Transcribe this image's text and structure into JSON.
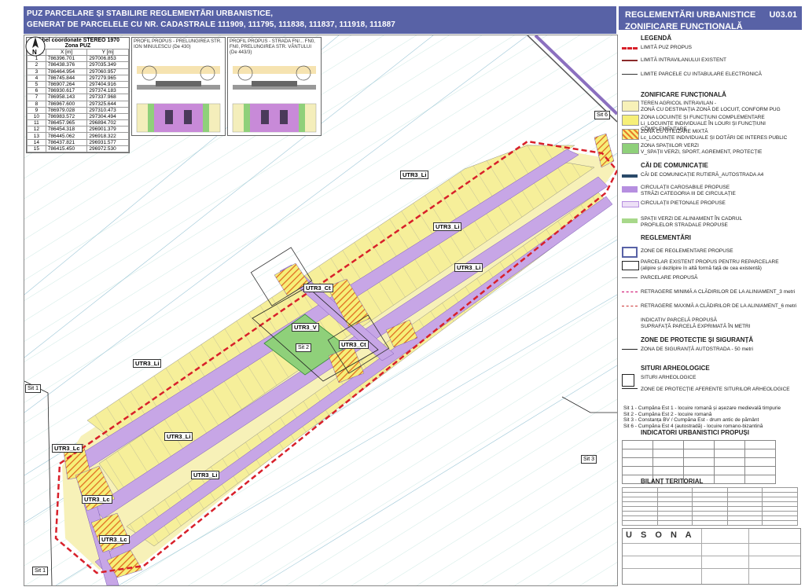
{
  "title": {
    "line1": "PUZ PARCELARE ȘI STABILIRE REGLEMENTĂRI URBANISTICE,",
    "line2": "GENERAT DE PARCELELE CU NR. CADASTRALE  111909, 111795, 111838, 111837, 111918, 111887"
  },
  "sheet": {
    "title": "REGLEMENTĂRI URBANISTICE",
    "subtitle": "ZONIFICARE FUNCȚIONALĂ",
    "code": "U03.01"
  },
  "coord_table": {
    "caption": "Tabel coordonate STEREO 1970",
    "subcaption": "Zona PUZ",
    "headers": [
      "Nr.pct.",
      "X [m]",
      "Y [m]"
    ],
    "rows": [
      [
        "1",
        "786396.701",
        "297006.853"
      ],
      [
        "2",
        "786438.376",
        "297035.349"
      ],
      [
        "3",
        "786464.954",
        "297060.957"
      ],
      [
        "4",
        "786745.844",
        "297279.965"
      ],
      [
        "5",
        "786907.264",
        "297404.916"
      ],
      [
        "6",
        "786930.617",
        "297374.183"
      ],
      [
        "7",
        "786958.143",
        "297337.968"
      ],
      [
        "8",
        "786967.600",
        "297325.644"
      ],
      [
        "9",
        "786979.028",
        "297310.473"
      ],
      [
        "10",
        "786983.572",
        "297304.494"
      ],
      [
        "11",
        "786457.965",
        "296894.702"
      ],
      [
        "12",
        "786454.318",
        "296901.379"
      ],
      [
        "13",
        "786445.062",
        "296918.322"
      ],
      [
        "14",
        "786437.821",
        "296931.577"
      ],
      [
        "15",
        "786415.450",
        "296972.530"
      ]
    ]
  },
  "profiles": [
    {
      "title": "PROFIL PROPUS - PRELUNGIREA STR. ION MINULESCU (De 430)"
    },
    {
      "title": "PROFIL PROPUS - STRADA FN/... FN0, FN0, PRELUNGIREA STR. VÂNTULUI (De 443/3)"
    }
  ],
  "map_labels": {
    "utr3_li": "UTR3_Li",
    "utr3_lc": "UTR3_Lc",
    "utr3_ct": "UTR3_Ct",
    "utr3_v": "UTR3_V",
    "sit1": "Sit 1",
    "sit2": "Sit 2",
    "sit3": "Sit 3",
    "sit6": "Sit 6",
    "de4433": "De 443/3"
  },
  "legend": {
    "heading": "LEGENDĂ",
    "items": [
      "LIMITĂ PUZ PROPUS",
      "LIMITĂ INTRAVILANULUI EXISTENT",
      "LIMITE PARCELE CU INTABULARE ELECTRONICĂ"
    ],
    "zon_heading": "ZONIFICARE FUNCȚIONALĂ",
    "zon_items": [
      {
        "l1": "TEREN AGRICOL INTRAVILAN -",
        "l2": "ZONĂ CU DESTINAȚIA ZONĂ DE LOCUIT, CONFORM PUG",
        "color": "#f7f1b8"
      },
      {
        "l1": "ZONA LOCUINȚE ȘI FUNCȚIUNI COMPLEMENTARE",
        "l2": "Li_LOCUINȚE INDIVIDUALE ÎN LOURI ȘI FUNCȚIUNI COMPLEMENTARE",
        "color": "#f6ef78"
      },
      {
        "l1": "ZONA CU UTILIZARE MIXTĂ",
        "l2": "Lc_LOCUINȚE INDIVIDUALE ȘI DOTĂRI DE INTERES PUBLIC",
        "color": "#e87a2a"
      },
      {
        "l1": "ZONA SPAȚIILOR VERZI",
        "l2": "V_SPAȚII VERZI, SPORT, AGREMENT, PROTECȚIE",
        "color": "#8fd07a"
      }
    ],
    "cai_heading": "CĂI DE COMUNICAȚIE",
    "cai_items": [
      "CĂI DE COMUNICAȚIE RUTIERĂ_AUTOSTRADA A4",
      "CIRCULAȚII CAROSABILE PROPUSE",
      "STRĂZI CATEGORIA III DE CIRCULAȚIE",
      "CIRCULAȚII PIETONALE PROPUSE",
      "SPAȚII VERZI DE ALINIAMENT ÎN CADRUL",
      "PROFILELOR STRADALE PROPUSE"
    ],
    "reg_heading": "REGLEMENTĂRI",
    "reg_items": [
      "ZONE DE REGLEMENTARE PROPUSE",
      "PARCELAR EXISTENT PROPUS PENTRU REPARCELARE",
      "(alipire și dezlipire în altă formă față de cea existentă)",
      "PARCELARE PROPUSĂ",
      "RETRAGERE MINIMĂ A CLĂDIRILOR DE LA ALINIAMENT_3 metri",
      "RETRAGERE MAXIMĂ A CLĂDIRILOR DE LA ALINIAMENT_6 metri",
      "INDICATIV PARCELĂ PROPUSĂ",
      "SUPRAFAȚĂ PARCELĂ EXPRIMATĂ ÎN METRI"
    ],
    "prot_heading": "ZONE DE PROTECȚIE ȘI SIGURANȚĂ",
    "prot_items": [
      "ZONA DE SIGURANȚĂ AUTOSTRADA - 50 metri"
    ],
    "arh_heading": "SITURI ARHEOLOGICE",
    "arh_items": [
      "SITURI ARHEOLOGICE",
      "ZONE DE PROTECȚIE AFERENTE SITURILOR ARHEOLOGICE"
    ],
    "sites": [
      "Sit 1 - Cumpăna Est 1 - locuire romană și așezare medievală timpurie",
      "Sit 2 - Cumpăna Est 2 - locuire romană",
      "Sit 3 - Constanța BV / Cumpăna Est - drum antic de pământ",
      "Sit 6 - Cumpăna Est 4 (autostradă) - locuire romano-bizantină"
    ],
    "ind_heading": "INDICATORI URBANISTICI PROPUȘI",
    "bil_heading": "BILANȚ TERITORIAL"
  },
  "cartouche": {
    "firm": "U S O N A"
  }
}
